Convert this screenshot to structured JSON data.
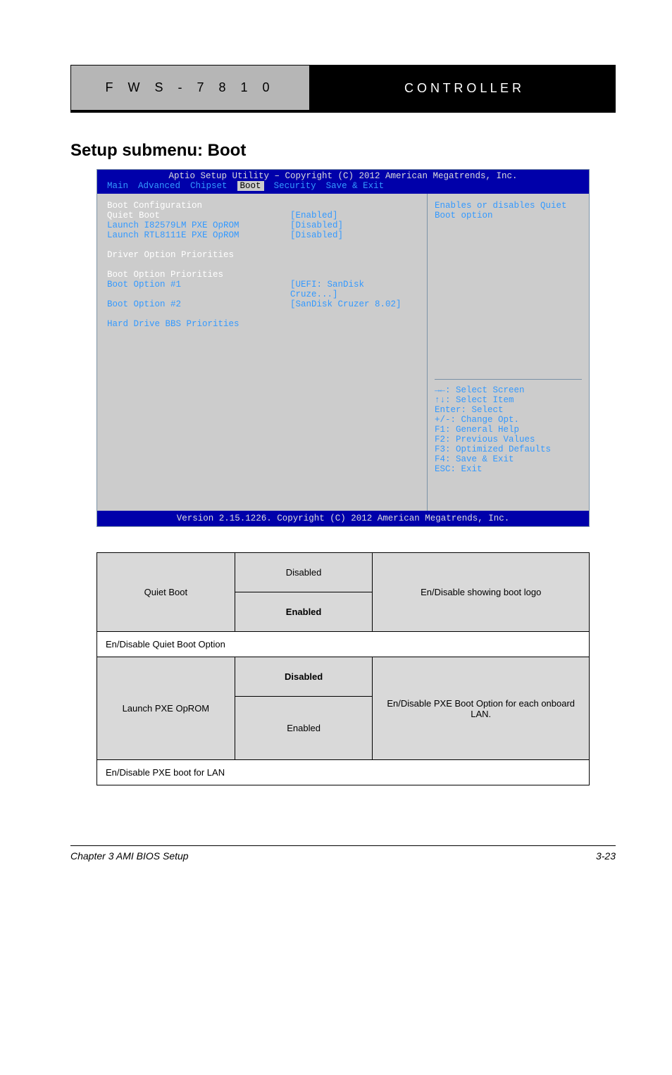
{
  "header": {
    "left": "F W S - 7 8 1 0",
    "right": "C O N T R O L L E R"
  },
  "section_title": "Setup submenu: Boot",
  "bios": {
    "title": "Aptio Setup Utility – Copyright (C) 2012 American Megatrends, Inc.",
    "tabs": [
      "Main",
      "Advanced",
      "Chipset",
      "Boot",
      "Security",
      "Save & Exit"
    ],
    "active_tab": "Boot",
    "left": {
      "heading1": "Boot Configuration",
      "rows1": [
        {
          "label": "Quiet Boot",
          "val": "[Enabled]",
          "highlight": true
        },
        {
          "label": "Launch I82579LM PXE OpROM",
          "val": "[Disabled]"
        },
        {
          "label": "Launch RTL8111E PXE OpROM",
          "val": "[Disabled]"
        }
      ],
      "heading2": "Driver Option Priorities",
      "heading3": "Boot Option Priorities",
      "rows2": [
        {
          "label": "Boot Option #1",
          "val": "[UEFI: SanDisk Cruze...]"
        },
        {
          "label": "Boot Option #2",
          "val": "[SanDisk Cruzer 8.02]"
        }
      ],
      "heading4": "Hard Drive BBS Priorities"
    },
    "right": {
      "desc": "Enables or disables Quiet Boot option",
      "keys": [
        "→←: Select Screen",
        "↑↓: Select Item",
        "Enter: Select",
        "+/-: Change Opt.",
        "F1: General Help",
        "F2: Previous Values",
        "F3: Optimized Defaults",
        "F4: Save & Exit",
        "ESC: Exit"
      ]
    },
    "footer": "Version 2.15.1226. Copyright (C) 2012 American Megatrends, Inc."
  },
  "table": {
    "r1": {
      "opt": "Quiet Boot",
      "v1": "Disabled",
      "v2_default": "Enabled",
      "desc": "En/Disable showing boot logo"
    },
    "r1_desc": "En/Disable Quiet Boot Option",
    "r2": {
      "opt": "Launch PXE OpROM",
      "v1_default": "Disabled",
      "v2": "Enabled",
      "desc": "En/Disable PXE Boot Option for each onboard LAN."
    },
    "r2_desc": "En/Disable PXE boot for LAN"
  },
  "footer": {
    "chapter": "Chapter 3 AMI BIOS Setup",
    "page": "3-23"
  }
}
